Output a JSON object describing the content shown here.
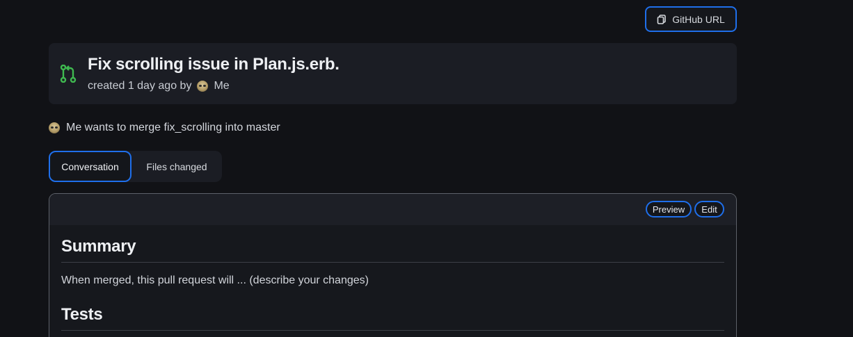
{
  "toolbar": {
    "github_url_label": "GitHub URL"
  },
  "pull_request": {
    "title": "Fix scrolling issue in Plan.js.erb.",
    "created_text": "created 1 day ago by",
    "author": "Me",
    "merge_text": "Me wants to merge fix_scrolling into master"
  },
  "tabs": [
    {
      "label": "Conversation",
      "active": true
    },
    {
      "label": "Files changed",
      "active": false
    }
  ],
  "editor": {
    "preview_label": "Preview",
    "edit_label": "Edit",
    "sections": [
      {
        "heading": "Summary",
        "body": "When merged, this pull request will ... (describe your changes)"
      },
      {
        "heading": "Tests",
        "body": ""
      }
    ]
  },
  "colors": {
    "accent": "#1f6feb",
    "pr_icon": "#3fb950",
    "background": "#111216"
  },
  "icons": {
    "copy": "copy-icon",
    "pull_request": "git-pull-request-icon"
  }
}
